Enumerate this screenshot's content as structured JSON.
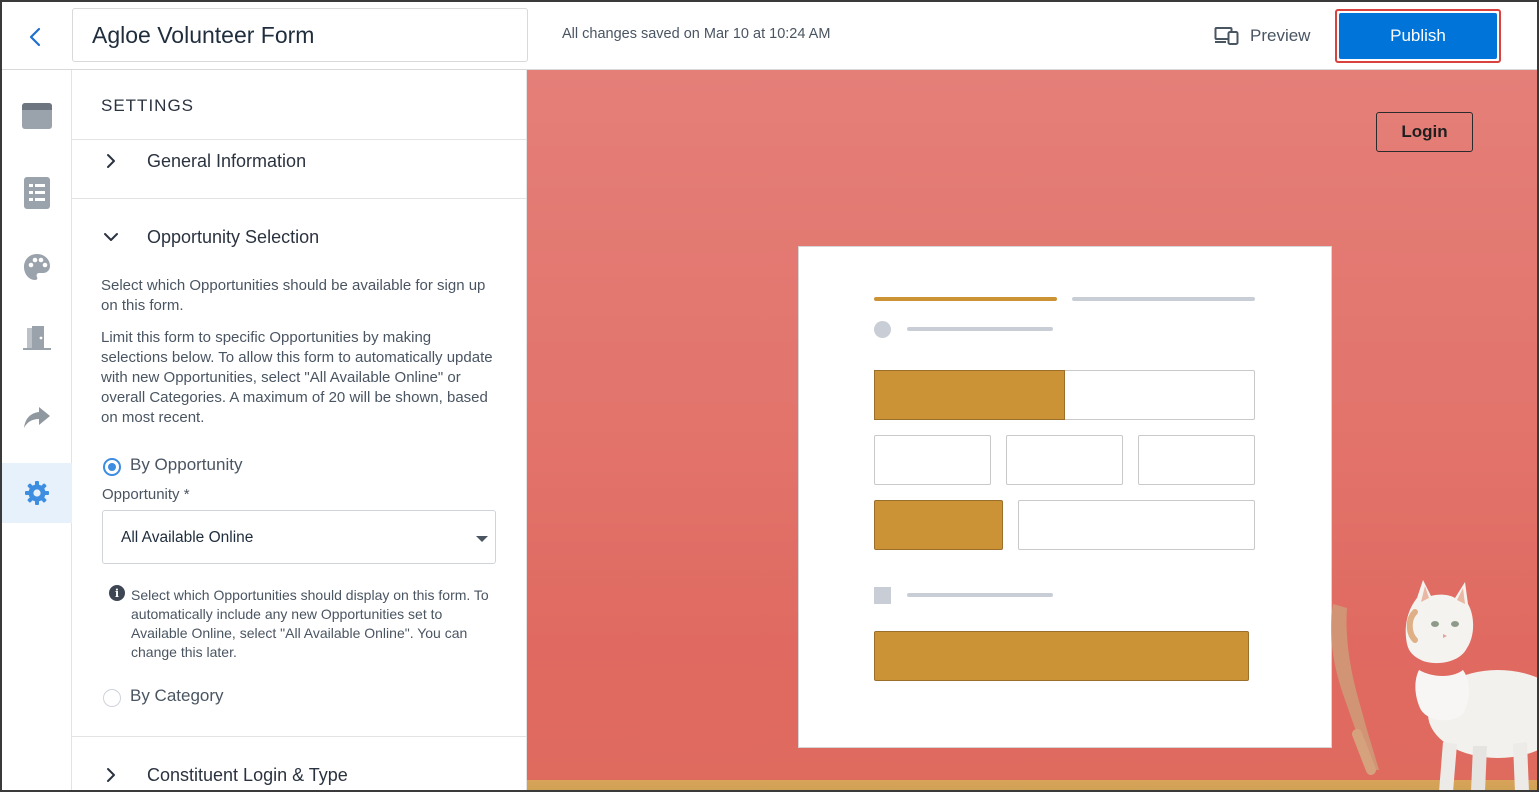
{
  "header": {
    "back_icon": "chevron-left-icon",
    "form_title": "Agloe Volunteer Form",
    "save_status": "All changes saved on Mar 10 at 10:24 AM",
    "preview_icon": "devices-icon",
    "preview_label": "Preview",
    "publish_label": "Publish"
  },
  "rail": {
    "items": [
      {
        "icon": "layout-icon",
        "active": false
      },
      {
        "icon": "list-icon",
        "active": false
      },
      {
        "icon": "palette-icon",
        "active": false
      },
      {
        "icon": "door-icon",
        "active": false
      },
      {
        "icon": "share-arrow-icon",
        "active": false
      },
      {
        "icon": "gear-icon",
        "active": true
      }
    ]
  },
  "settings": {
    "title": "SETTINGS",
    "sections": {
      "general": "General Information",
      "opportunity": "Opportunity Selection",
      "constituent": "Constituent Login & Type"
    },
    "description_1": "Select which Opportunities should be available for sign up on this form.",
    "description_2": "Limit this form to specific Opportunities by making selections below. To allow this form to automatically update with new Opportunities, select \"All Available Online\" or overall Categories. A maximum of 20 will be shown, based on most recent.",
    "radio_by_opportunity": "By Opportunity",
    "radio_by_category": "By Category",
    "selected_mode": "By Opportunity",
    "opportunity_label": "Opportunity *",
    "opportunity_value": "All Available Online",
    "hint": "Select which Opportunities should display on this form. To automatically include any new Opportunities set to Available Online, select \"All Available Online\". You can change this later."
  },
  "preview": {
    "login_label": "Login"
  },
  "colors": {
    "accent_blue": "#0074d9",
    "publish_highlight": "#d9433f",
    "active_rail_bg": "#e7f1fb",
    "preview_background": "#e2756d",
    "placeholder_gold": "#cb9236"
  }
}
